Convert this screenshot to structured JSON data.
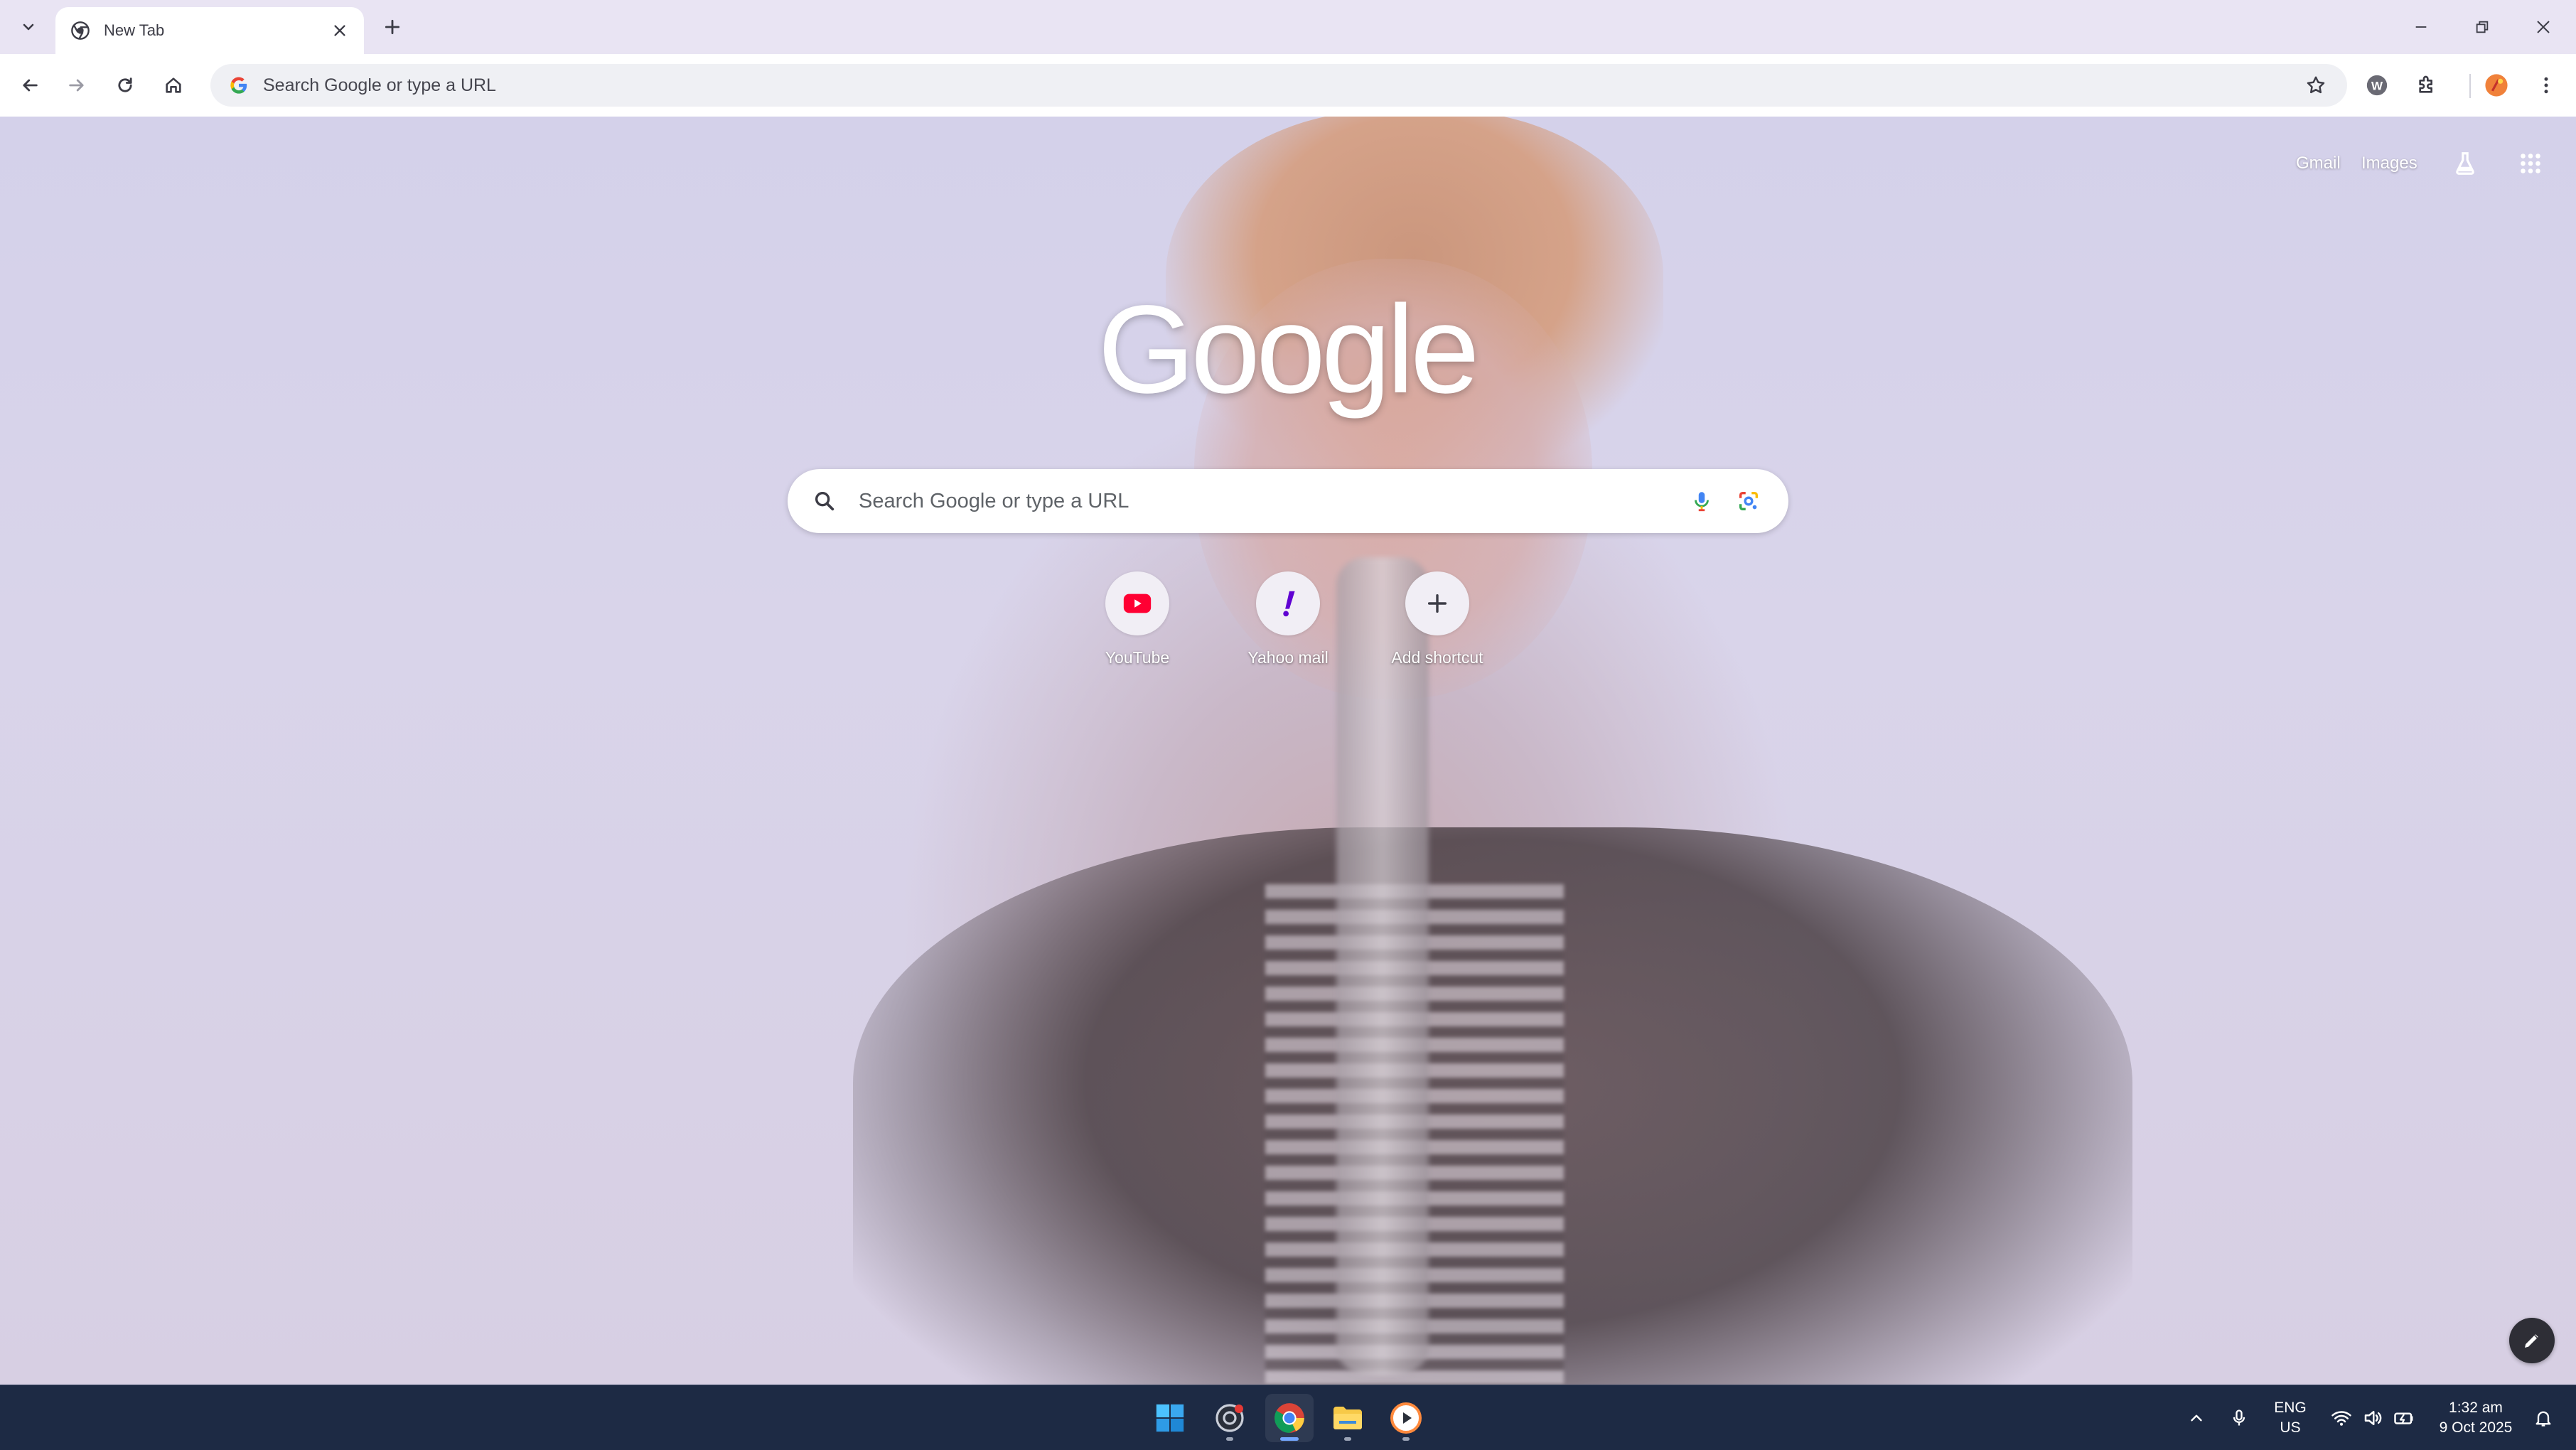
{
  "browser": {
    "tab": {
      "title": "New Tab"
    },
    "omnibox": {
      "placeholder": "Search Google or type a URL"
    }
  },
  "ntp": {
    "links": {
      "gmail": "Gmail",
      "images": "Images"
    },
    "logo_text": "Google",
    "search": {
      "placeholder": "Search Google or type a URL"
    },
    "shortcuts": [
      {
        "label": "YouTube",
        "icon": "youtube-icon"
      },
      {
        "label": "Yahoo mail",
        "icon": "yahoo-mail-icon"
      },
      {
        "label": "Add shortcut",
        "icon": "plus-icon"
      }
    ]
  },
  "taskbar": {
    "apps": [
      "windows-start",
      "recorder",
      "chrome",
      "file-explorer",
      "media-player"
    ],
    "tray": {
      "lang_primary": "ENG",
      "lang_secondary": "US",
      "time": "1:32 am",
      "date": "9 Oct 2025"
    }
  },
  "colors": {
    "tab_strip": "#e9e4f3",
    "taskbar": "#1d2a44",
    "youtube_red": "#ff0033",
    "yahoo_purple": "#6001d2"
  }
}
